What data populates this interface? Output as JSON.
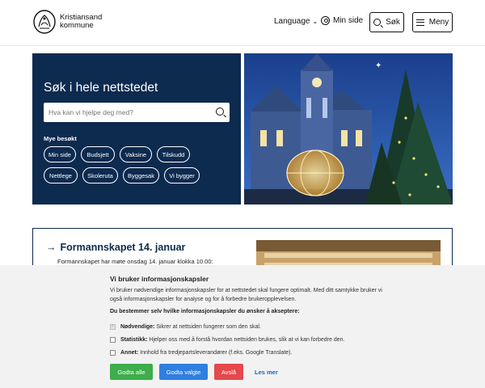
{
  "header": {
    "logo_line1": "Kristiansand",
    "logo_line2": "kommune",
    "language_label": "Language",
    "minside_label": "Min side",
    "search_label": "Søk",
    "menu_label": "Meny"
  },
  "hero": {
    "title": "Søk i hele nettstedet",
    "search_placeholder": "Hva kan vi hjelpe deg med?",
    "popular_label": "Mye besøkt",
    "chips": [
      "Min side",
      "Budsjett",
      "Vaksine",
      "Tilskudd",
      "Nettlege",
      "Skoleruta",
      "Byggesak",
      "Vi bygger"
    ]
  },
  "news": {
    "title": "Formannskapet 14. januar",
    "text": "Formannskapet har møte onsdag 14. januar klokka 10.00:"
  },
  "cookie": {
    "title": "Vi bruker informasjonskapsler",
    "description": "Vi bruker nødvendige informasjonskapsler for at nettstedet skal fungere optimalt. Med ditt samtykke bruker vi også informasjonskapsler for analyse og for å forbedre brukeropplevelsen.",
    "subtitle": "Du bestemmer selv hvilke informasjonskapsler du ønsker å akseptere:",
    "options": [
      {
        "label": "Nødvendige:",
        "text": "Sikrer at nettsiden fungerer som den skal.",
        "checked": true
      },
      {
        "label": "Statistikk:",
        "text": "Hjelper oss med å forstå hvordan nettsiden brukes, slik at vi kan forbedre den.",
        "checked": false
      },
      {
        "label": "Annet:",
        "text": "Innhold fra tredjepartsleverandører (f.eks. Google Translate).",
        "checked": false
      }
    ],
    "accept_all": "Godta alle",
    "accept_selected": "Godta valgte",
    "reject": "Avslå",
    "read_more": "Les mer"
  },
  "colors": {
    "hero_navy": "#0d2a4f",
    "accept_all_green": "#3cae4a",
    "accept_selected_blue": "#2f7fe0",
    "reject_red": "#e5484d",
    "link_blue": "#1a5fd1"
  }
}
